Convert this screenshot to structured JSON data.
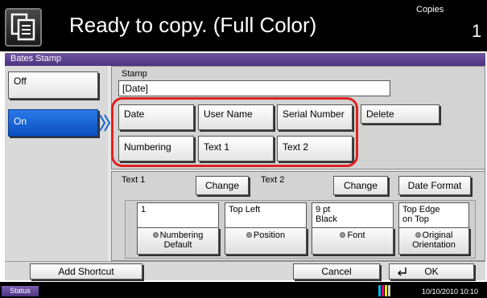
{
  "header": {
    "title": "Ready to copy. (Full Color)",
    "copies_label": "Copies",
    "copies_value": "1",
    "icon": "copy-icon"
  },
  "dialog": {
    "title": "Bates Stamp",
    "mode_buttons": {
      "off": "Off",
      "on": "On",
      "selected": "On"
    },
    "stamp": {
      "label": "Stamp",
      "value": "[Date]",
      "buttons": [
        "Date",
        "User Name",
        "Serial Number",
        "Delete",
        "Numbering",
        "Text 1",
        "Text 2"
      ]
    },
    "text_row": {
      "text1_label": "Text 1",
      "text1_change": "Change",
      "text2_label": "Text 2",
      "text2_change": "Change",
      "date_format": "Date Format"
    },
    "settings": [
      {
        "value_line1": "1",
        "value_line2": "",
        "button_line1": "Numbering",
        "button_line2": "Default"
      },
      {
        "value_line1": "Top Left",
        "value_line2": "",
        "button_line1": "Position",
        "button_line2": ""
      },
      {
        "value_line1": "9 pt",
        "value_line2": "Black",
        "button_line1": "Font",
        "button_line2": ""
      },
      {
        "value_line1": "Top Edge",
        "value_line2": "on Top",
        "button_line1": "Original",
        "button_line2": "Orientation"
      }
    ],
    "footer": {
      "add_shortcut": "Add Shortcut",
      "cancel": "Cancel",
      "ok": "OK"
    }
  },
  "status_bar": {
    "label": "Status",
    "datetime": "10/10/2010  10:10"
  },
  "colors": {
    "accent_purple": "#5a3e8c",
    "selected_blue": "#1463d6",
    "highlight_red": "#e02020"
  }
}
